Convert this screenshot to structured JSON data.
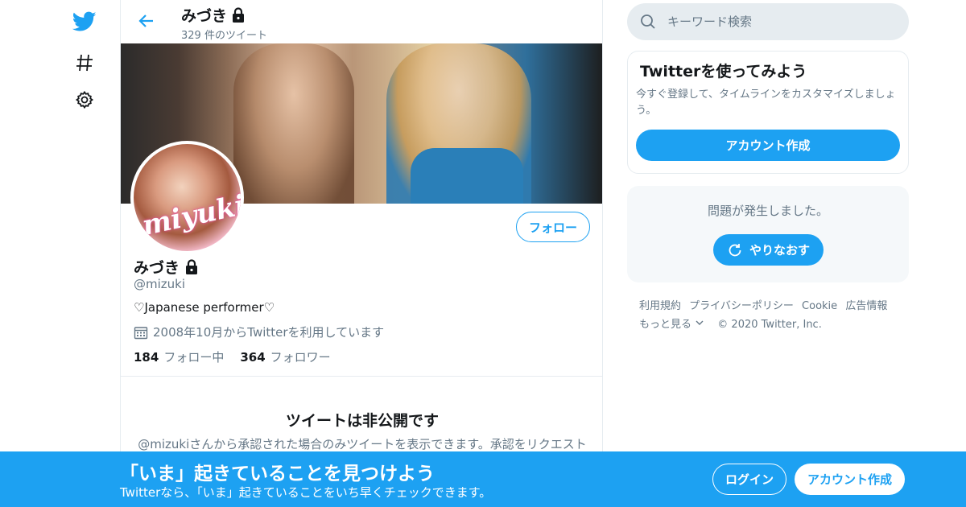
{
  "nav": {
    "icons": [
      "twitter-bird-icon",
      "hashtag-icon",
      "settings-gear-icon"
    ]
  },
  "header": {
    "name": "みづき",
    "tweet_count": "329 件のツイート"
  },
  "profile": {
    "avatar_text": "miyuki",
    "name": "みづき",
    "handle": "@mizuki",
    "bio": "♡Japanese performer♡",
    "joined": "2008年10月からTwitterを利用しています",
    "following_count": "184",
    "following_label": "フォロー中",
    "followers_count": "364",
    "followers_label": "フォロワー",
    "follow_button": "フォロー"
  },
  "protected": {
    "title": "ツイートは非公開です",
    "text": "@mizukiさんから承認された場合のみツイートを表示できます。承認をリクエスト"
  },
  "search": {
    "placeholder": "キーワード検索"
  },
  "signup_card": {
    "title": "Twitterを使ってみよう",
    "text": "今すぐ登録して、タイムラインをカスタマイズしましょう。",
    "button": "アカウント作成"
  },
  "error_card": {
    "text": "問題が発生しました。",
    "retry_button": "やりなおす"
  },
  "footer": {
    "links": [
      "利用規約",
      "プライバシーポリシー",
      "Cookie",
      "広告情報"
    ],
    "more": "もっと見る",
    "copyright": "© 2020 Twitter, Inc."
  },
  "bottom_bar": {
    "title": "「いま」起きていることを見つけよう",
    "subtitle": "Twitterなら、「いま」起きていることをいち早くチェックできます。",
    "login_button": "ログイン",
    "signup_button": "アカウント作成"
  },
  "colors": {
    "accent": "#1da1f2",
    "secondary_text": "#657786",
    "border": "#e6ecf0"
  }
}
